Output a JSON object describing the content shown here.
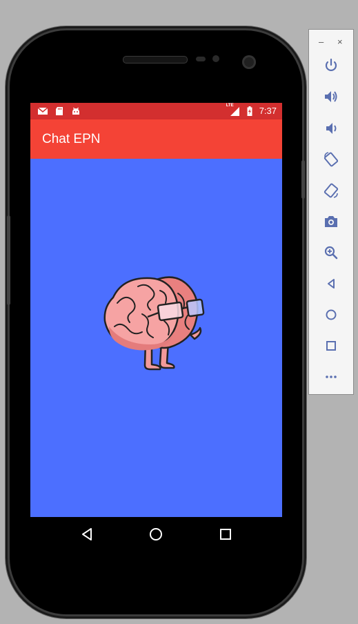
{
  "app": {
    "title": "Chat EPN",
    "colors": {
      "status_bar": "#d32f2f",
      "app_bar": "#f44336",
      "content_background": "#4c6fff",
      "toolbar_icon": "#5a6fb0"
    }
  },
  "status_bar": {
    "time": "7:37",
    "network_label": "LTE",
    "left_icons": [
      "gmail-notification-icon",
      "sd-card-icon",
      "android-debug-icon"
    ],
    "right_icons": [
      "lte-signal-icon",
      "battery-charging-icon"
    ]
  },
  "content": {
    "image": "brain-with-glasses-illustration"
  },
  "nav_bar": {
    "buttons": [
      "back-icon",
      "home-icon",
      "recents-icon"
    ]
  },
  "emulator_toolbar": {
    "minimize_label": "–",
    "close_label": "×",
    "buttons": [
      "power-icon",
      "volume-up-icon",
      "volume-down-icon",
      "rotate-left-icon",
      "rotate-right-icon",
      "screenshot-camera-icon",
      "zoom-icon",
      "back-icon",
      "home-icon",
      "overview-icon",
      "more-icon"
    ]
  }
}
